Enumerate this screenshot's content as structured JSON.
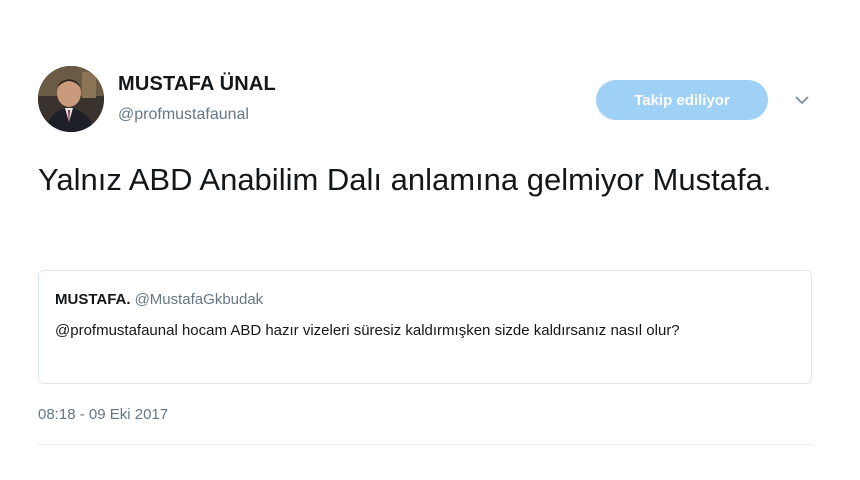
{
  "author": {
    "display_name": "MUSTAFA ÜNAL",
    "handle": "@profmustafaunal",
    "avatar_icon": "profile-photo"
  },
  "follow_button": {
    "label": "Takip ediliyor",
    "color": "#9fd0f6"
  },
  "menu": {
    "icon": "chevron-down-icon"
  },
  "tweet": {
    "text": "Yalnız ABD Anabilim Dalı anlamına gelmiyor Mustafa."
  },
  "quoted_tweet": {
    "display_name": "MUSTAFA.",
    "handle": "@MustafaGkbudak",
    "text": "@profmustafaunal hocam ABD hazır vizeleri süresiz kaldırmışken sizde kaldırsanız nasıl olur?"
  },
  "meta": {
    "timestamp": "08:18 - 09 Eki 2017"
  },
  "colors": {
    "text_primary": "#14171a",
    "text_secondary": "#657786",
    "border": "#e1e8ed"
  }
}
